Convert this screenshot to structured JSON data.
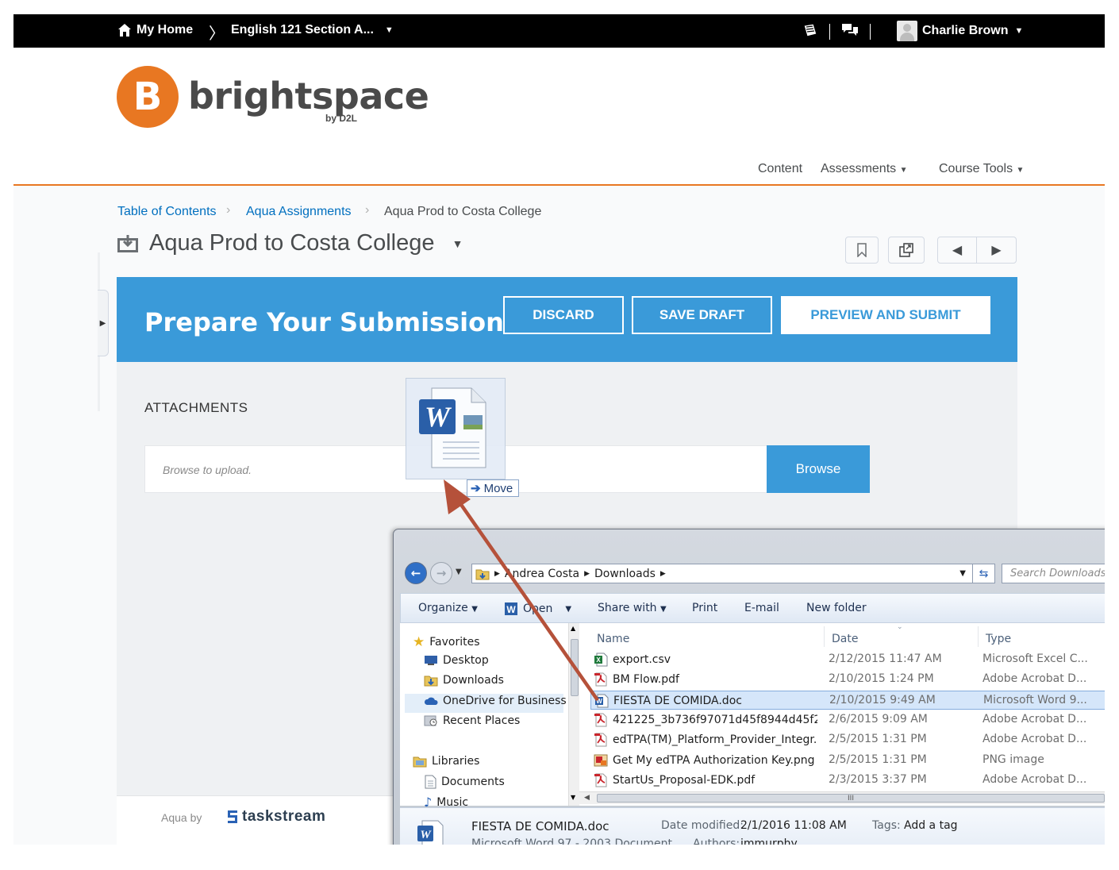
{
  "topnav": {
    "home_label": "My Home",
    "course_label": "English 121 Section A...",
    "user_name": "Charlie Brown"
  },
  "brand": {
    "name": "brightspace",
    "sub": "by D2L",
    "accent": "#e87722"
  },
  "course_nav": {
    "items": [
      "Content",
      "Assessments",
      "Course Tools"
    ]
  },
  "breadcrumb": [
    "Table of Contents",
    "Aqua Assignments",
    "Aqua Prod to Costa College"
  ],
  "page_title": "Aqua Prod to Costa College",
  "aqua": {
    "accent": "#3a9ad9",
    "banner_title": "Prepare Your Submission",
    "discard": "DISCARD",
    "save_draft": "SAVE DRAFT",
    "preview_submit": "PREVIEW AND SUBMIT",
    "attachments_label": "ATTACHMENTS",
    "upload_placeholder": "Browse to upload.",
    "browse": "Browse",
    "drag_badge": "Move",
    "footer_prefix": "Aqua by",
    "footer_brand": "taskstream"
  },
  "explorer": {
    "path": [
      "Andrea Costa",
      "Downloads"
    ],
    "search_placeholder": "Search Downloads",
    "commands": [
      "Organize",
      "Open",
      "Share with",
      "Print",
      "E-mail",
      "New folder"
    ],
    "nav": {
      "favorites": "Favorites",
      "favorites_items": [
        "Desktop",
        "Downloads",
        "OneDrive for Business",
        "Recent Places"
      ],
      "libraries": "Libraries",
      "libraries_items": [
        "Documents",
        "Music"
      ]
    },
    "columns": [
      "Name",
      "Date",
      "Type"
    ],
    "files": [
      {
        "name": "export.csv",
        "date": "2/12/2015 11:47 AM",
        "type": "Microsoft Excel C...",
        "icon": "excel-icon"
      },
      {
        "name": "BM Flow.pdf",
        "date": "2/10/2015 1:24 PM",
        "type": "Adobe Acrobat D...",
        "icon": "pdf-icon"
      },
      {
        "name": "FIESTA DE COMIDA.doc",
        "date": "2/10/2015 9:49 AM",
        "type": "Microsoft Word 9...",
        "icon": "word-icon"
      },
      {
        "name": "421225_3b736f97071d45f8944d45f298a...",
        "date": "2/6/2015 9:09 AM",
        "type": "Adobe Acrobat D...",
        "icon": "pdf-icon"
      },
      {
        "name": "edTPA(TM)_Platform_Provider_Integr...",
        "date": "2/5/2015 1:31 PM",
        "type": "Adobe Acrobat D...",
        "icon": "pdf-icon"
      },
      {
        "name": "Get My edTPA Authorization Key.png",
        "date": "2/5/2015 1:31 PM",
        "type": "PNG image",
        "icon": "image-icon"
      },
      {
        "name": "StartUs_Proposal-EDK.pdf",
        "date": "2/3/2015 3:37 PM",
        "type": "Adobe Acrobat D...",
        "icon": "pdf-icon"
      }
    ],
    "selected_index": 2,
    "hscroll_grip": "III",
    "details": {
      "filename": "FIESTA DE COMIDA.doc",
      "filetype": "Microsoft Word 97 - 2003 Document",
      "date_modified_label": "Date modified:",
      "date_modified": "2/1/2016 11:08 AM",
      "authors_label": "Authors:",
      "authors": "jmmurphy",
      "tags_label": "Tags:",
      "tags": "Add a tag"
    }
  }
}
